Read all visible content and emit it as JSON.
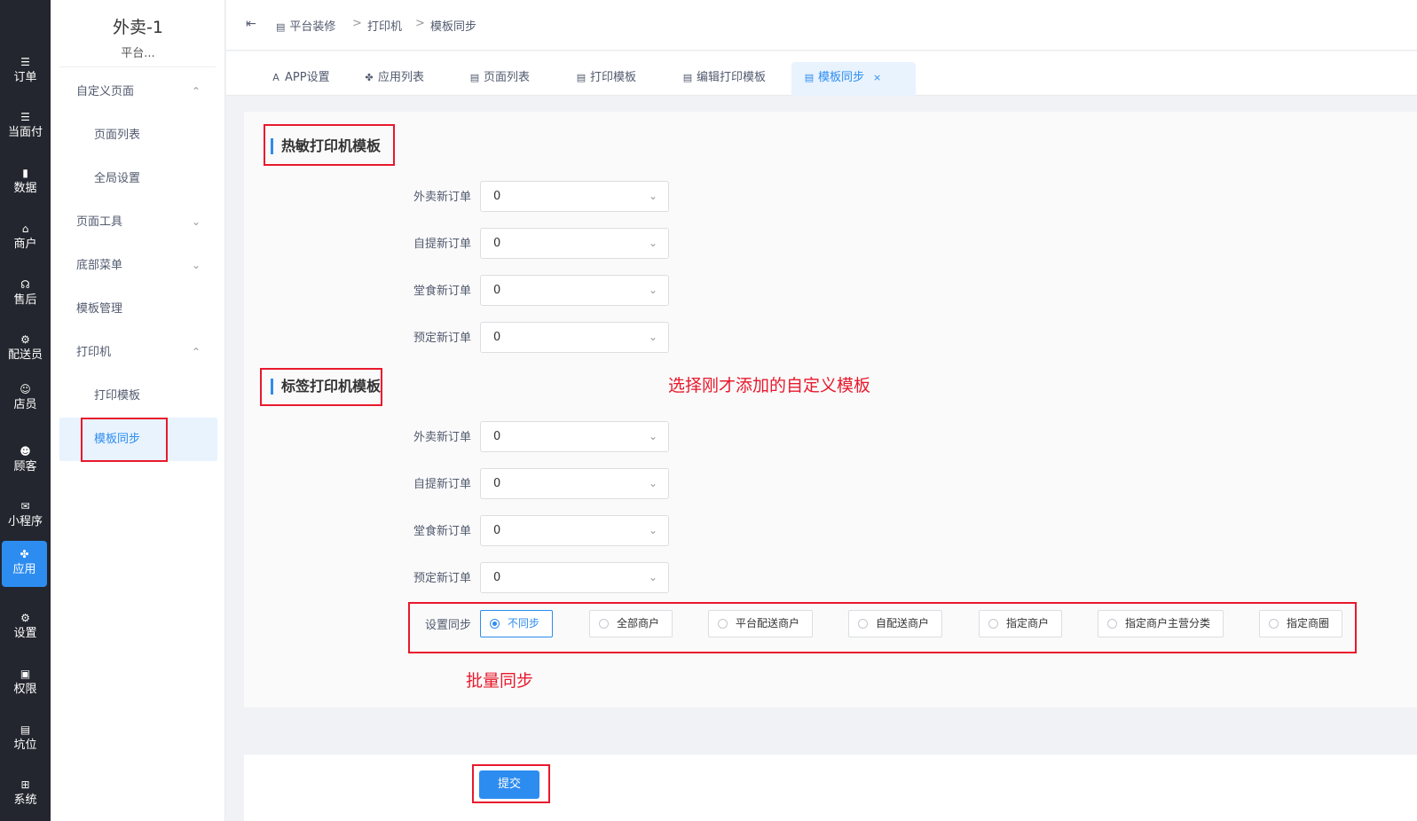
{
  "rail": [
    {
      "label": "订单",
      "icon": "list-icon",
      "glyph": "☰"
    },
    {
      "label": "当面付",
      "icon": "list-icon",
      "glyph": "☰"
    },
    {
      "label": "数据",
      "icon": "bar-chart-icon",
      "glyph": "▮"
    },
    {
      "label": "商户",
      "icon": "store-icon",
      "glyph": "⌂"
    },
    {
      "label": "售后",
      "icon": "headset-icon",
      "glyph": "☊"
    },
    {
      "label": "配送员",
      "icon": "scooter-icon",
      "glyph": "⚙"
    },
    {
      "label": "店员",
      "icon": "user-icon",
      "glyph": "☺"
    },
    {
      "label": "顾客",
      "icon": "customer-icon",
      "glyph": "☻"
    },
    {
      "label": "小程序",
      "icon": "wechat-icon",
      "glyph": "✉"
    },
    {
      "label": "应用",
      "icon": "apps-icon",
      "glyph": "✤"
    },
    {
      "label": "设置",
      "icon": "user-settings-icon",
      "glyph": "⚙"
    },
    {
      "label": "权限",
      "icon": "lock-icon",
      "glyph": "▣"
    },
    {
      "label": "坑位",
      "icon": "report-icon",
      "glyph": "▤"
    },
    {
      "label": "系统",
      "icon": "windows-icon",
      "glyph": "⊞"
    }
  ],
  "sidebar": {
    "title": "外卖-1",
    "subtitle": "平台...",
    "items": [
      {
        "label": "自定义页面",
        "arrow": "⌃"
      },
      {
        "label": "页面列表"
      },
      {
        "label": "全局设置"
      },
      {
        "label": "页面工具",
        "arrow": "⌄"
      },
      {
        "label": "底部菜单",
        "arrow": "⌄"
      },
      {
        "label": "模板管理"
      },
      {
        "label": "打印机",
        "arrow": "⌃"
      },
      {
        "label": "打印模板"
      },
      {
        "label": "模板同步"
      }
    ]
  },
  "breadcrumb": {
    "toggle": "⇤",
    "items": [
      "平台装修",
      "打印机",
      "模板同步"
    ],
    "sep": ">"
  },
  "tabs": [
    {
      "label": "APP设置",
      "icon": "A"
    },
    {
      "label": "应用列表",
      "icon": "✤"
    },
    {
      "label": "页面列表",
      "icon": "▤"
    },
    {
      "label": "打印模板",
      "icon": "▤"
    },
    {
      "label": "编辑打印模板",
      "icon": "▤"
    },
    {
      "label": "模板同步",
      "icon": "▤",
      "close": "×"
    }
  ],
  "thermal": {
    "title": "热敏打印机模板",
    "fields": [
      {
        "label": "外卖新订单",
        "value": "0"
      },
      {
        "label": "自提新订单",
        "value": "0"
      },
      {
        "label": "堂食新订单",
        "value": "0"
      },
      {
        "label": "预定新订单",
        "value": "0"
      }
    ]
  },
  "label_printer": {
    "title": "标签打印机模板",
    "fields": [
      {
        "label": "外卖新订单",
        "value": "0"
      },
      {
        "label": "自提新订单",
        "value": "0"
      },
      {
        "label": "堂食新订单",
        "value": "0"
      },
      {
        "label": "预定新订单",
        "value": "0"
      }
    ]
  },
  "sync": {
    "label": "设置同步",
    "options": [
      "不同步",
      "全部商户",
      "平台配送商户",
      "自配送商户",
      "指定商户",
      "指定商户主营分类",
      "指定商圈"
    ],
    "selected": "不同步"
  },
  "annotations": {
    "select_custom": "选择刚才添加的自定义模板",
    "batch_sync": "批量同步"
  },
  "submit_label": "提交",
  "colors": {
    "accent": "#2d8cf0",
    "annotation": "#e8192c",
    "rail_bg": "#23262e"
  }
}
